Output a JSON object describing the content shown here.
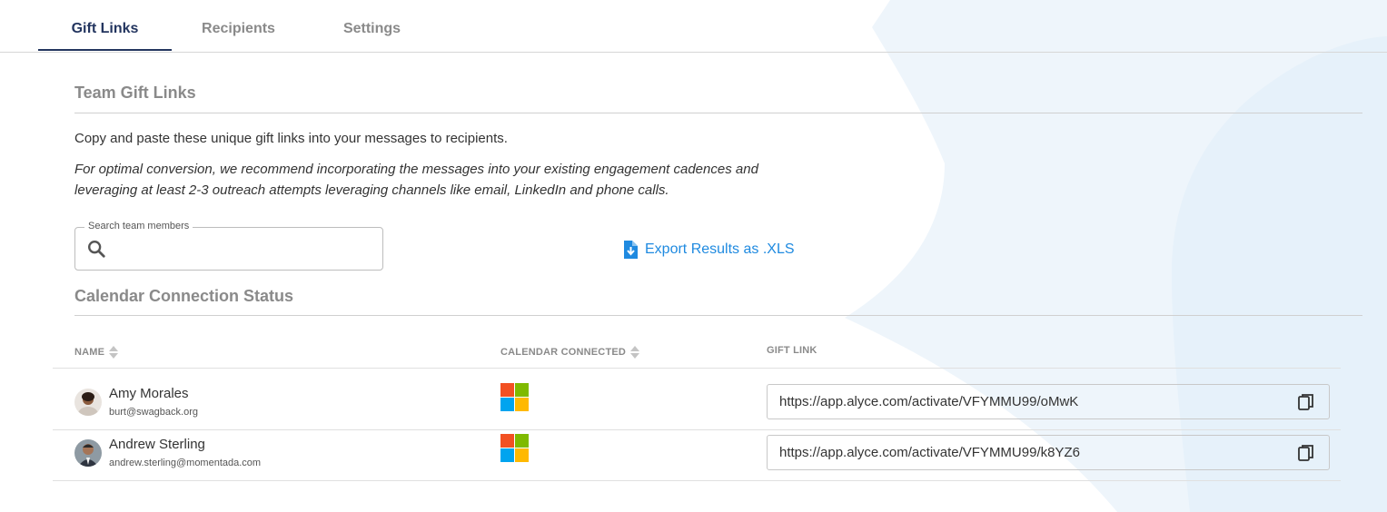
{
  "tabs": [
    {
      "label": "Gift Links",
      "active": true
    },
    {
      "label": "Recipients",
      "active": false
    },
    {
      "label": "Settings",
      "active": false
    }
  ],
  "section_team": {
    "title": "Team Gift Links"
  },
  "intro_text": "Copy and paste these unique gift links into your messages to recipients.",
  "note_text": "For optimal conversion, we recommend incorporating the messages into your existing engagement cadences and leveraging at least 2-3 outreach attempts leveraging channels like email, LinkedIn and phone calls.",
  "search": {
    "label": "Search team members",
    "value": "",
    "icon": "search-icon"
  },
  "export": {
    "label": "Export Results as .XLS",
    "icon": "file-download-icon"
  },
  "section_calendar": {
    "title": "Calendar Connection Status"
  },
  "table": {
    "columns": [
      {
        "label": "NAME",
        "sortable": true
      },
      {
        "label": "CALENDAR CONNECTED",
        "sortable": true
      },
      {
        "label": "GIFT LINK",
        "sortable": false
      }
    ],
    "rows": [
      {
        "name": "Amy Morales",
        "email": "burt@swagback.org",
        "calendar": "microsoft-icon",
        "link": "https://app.alyce.com/activate/VFYMMU99/oMwK"
      },
      {
        "name": "Andrew Sterling",
        "email": "andrew.sterling@momentada.com",
        "calendar": "microsoft-icon",
        "link": "https://app.alyce.com/activate/VFYMMU99/k8YZ6"
      }
    ]
  },
  "colors": {
    "accent_navy": "#23355f",
    "link_blue": "#1f8ae0",
    "muted_gray": "#8a8a8a",
    "bg_deco": "#eef5fb",
    "ms_red": "#f25022",
    "ms_green": "#7fba00",
    "ms_blue": "#00a4ef",
    "ms_yellow": "#ffb900"
  }
}
